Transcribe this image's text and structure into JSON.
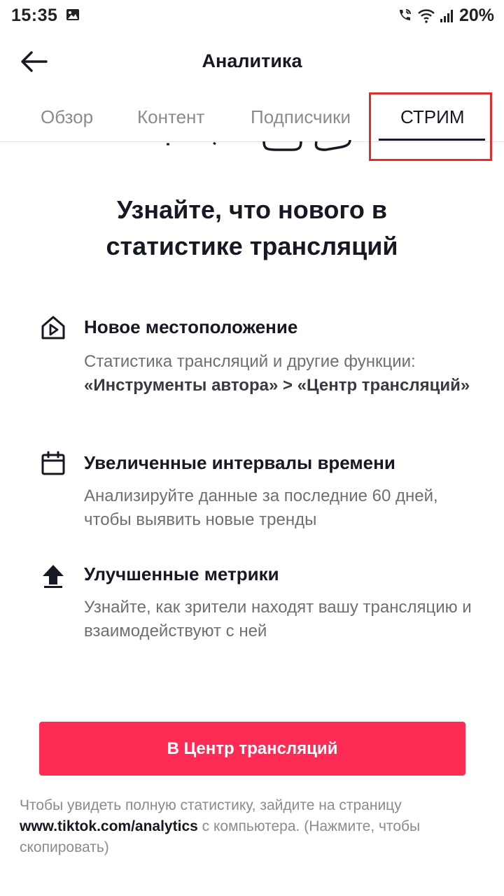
{
  "status_bar": {
    "time": "15:35",
    "battery": "20%",
    "icons": [
      "gallery-icon",
      "wifi-call-icon",
      "wifi-icon",
      "signal-icon"
    ]
  },
  "header": {
    "title": "Аналитика",
    "back_icon": "back-arrow-icon"
  },
  "tabs": [
    {
      "label": "Обзор",
      "active": false
    },
    {
      "label": "Контент",
      "active": false
    },
    {
      "label": "Подписчики",
      "active": false
    },
    {
      "label": "СТРИМ",
      "active": true
    }
  ],
  "heading": {
    "line1": "Узнайте, что нового в",
    "line2": "статистике трансляций"
  },
  "features": [
    {
      "icon": "home-play-icon",
      "title": "Новое местоположение",
      "desc_text": "Статистика трансляций и другие функции:",
      "desc_bold": "«Инструменты автора» > «Центр трансляций»"
    },
    {
      "icon": "calendar-icon",
      "title": "Увеличенные интервалы времени",
      "desc": "Анализируйте данные за последние 60 дней, чтобы выявить новые тренды"
    },
    {
      "icon": "arrow-up-icon",
      "title": "Улучшенные метрики",
      "desc": "Узнайте, как зрители находят вашу трансляцию и взаимодействуют с ней"
    }
  ],
  "cta": {
    "label": "В Центр трансляций"
  },
  "footer": {
    "text_before": "Чтобы увидеть полную статистику, зайдите на страницу",
    "link": "www.tiktok.com/analytics",
    "text_after": " с компьютера. (Нажмите, чтобы скопировать)"
  },
  "colors": {
    "accent": "#fe2c55",
    "highlight": "#e02e2e",
    "text_primary": "#161823",
    "text_secondary": "#6e6f74"
  }
}
